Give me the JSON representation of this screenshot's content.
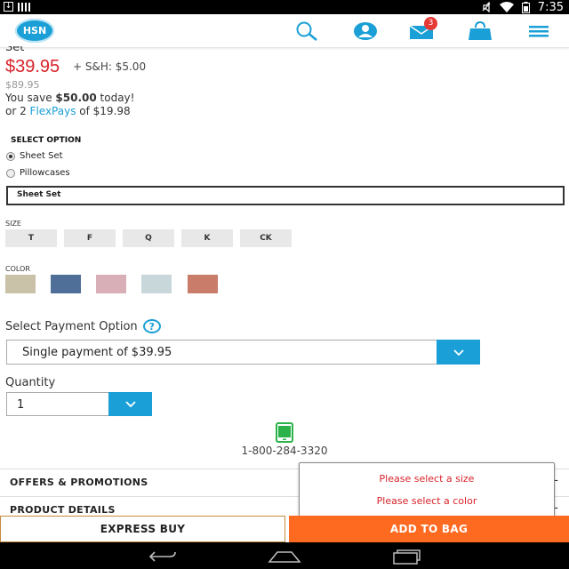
{
  "status_bar": {
    "time": "7:35",
    "icons": [
      "download-icon",
      "signal-bars-icon",
      "mute-icon",
      "wifi-icon",
      "battery-icon"
    ]
  },
  "header": {
    "logo_text": "HSN",
    "icons": [
      "search-icon",
      "account-icon",
      "mail-icon",
      "bag-icon",
      "menu-icon"
    ],
    "mail_badge": "3",
    "accent_color": "#1a9fd6"
  },
  "product": {
    "title_fragment": "Set",
    "price": "$39.95",
    "shipping": "+ S&H: $5.00",
    "original_price": "$89.95",
    "save_prefix": "You save ",
    "save_amount": "$50.00",
    "save_suffix": " today!",
    "flexpay_prefix": "or 2 ",
    "flexpay_link": "FlexPays",
    "flexpay_suffix": " of $19.98",
    "price_color": "#d8232a"
  },
  "select_option": {
    "label": "SELECT OPTION",
    "options": [
      {
        "label": "Sheet Set",
        "selected": true
      },
      {
        "label": "Pillowcases",
        "selected": false
      }
    ],
    "selected_value": "Sheet Set"
  },
  "size": {
    "label": "SIZE",
    "options": [
      "T",
      "F",
      "Q",
      "K",
      "CK"
    ]
  },
  "color": {
    "label": "COLOR",
    "swatches": [
      "#c9c1a8",
      "#4f6f98",
      "#d8aeb7",
      "#c8d7da",
      "#c97c6a"
    ]
  },
  "payment": {
    "label": "Select Payment Option",
    "help": "?",
    "selected": "Single payment of $39.95"
  },
  "quantity": {
    "label": "Quantity",
    "selected": "1"
  },
  "contact": {
    "phone": "1-800-284-3320"
  },
  "accordion": {
    "offers_label": "OFFERS & PROMOTIONS",
    "details_label": "PRODUCT DETAILS",
    "toggle": "-"
  },
  "popup": {
    "messages": [
      "Please select a size",
      "Please select a color"
    ]
  },
  "actions": {
    "express_buy": "EXPRESS BUY",
    "add_to_bag": "ADD TO BAG",
    "add_color": "#ff6a21"
  },
  "nav_bar": {
    "icons": [
      "back-icon",
      "home-icon",
      "recent-apps-icon"
    ]
  }
}
